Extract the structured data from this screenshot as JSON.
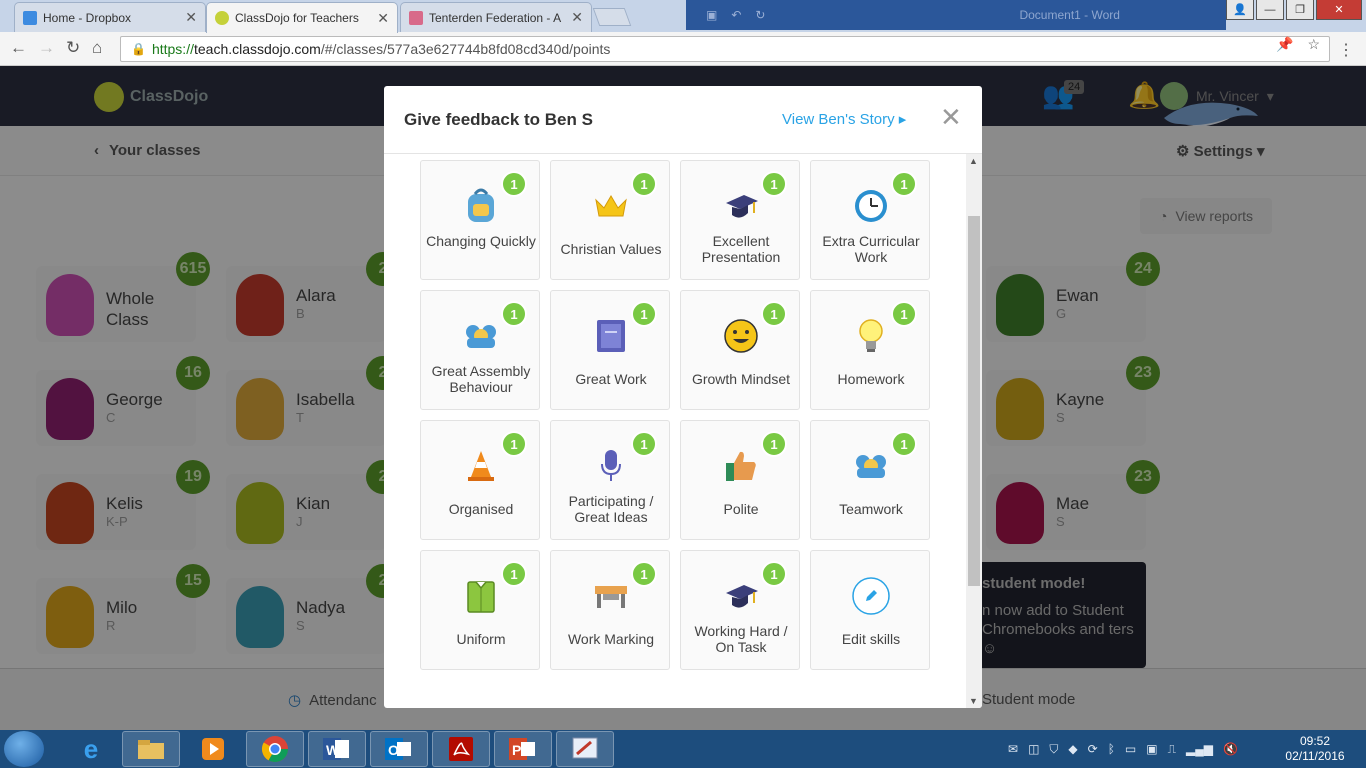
{
  "browser": {
    "tabs": [
      {
        "title": "Home - Dropbox",
        "close": "✕"
      },
      {
        "title": "ClassDojo for Teachers",
        "close": "✕"
      },
      {
        "title": "Tenterden Federation - A",
        "close": "✕"
      }
    ],
    "background_window_title": "Document1 - Word",
    "url_prefix": "https://",
    "url_host": "teach.classdojo.com",
    "url_path": "/#/classes/577a3e627744b8fd08cd340d/points"
  },
  "header": {
    "logo": "ClassDojo",
    "notifications_count": "24",
    "user_name": "Mr. Vincer"
  },
  "subbar": {
    "back_label": "Your classes",
    "settings_label": "Settings",
    "view_reports_label": "View reports"
  },
  "students": [
    {
      "name": "Whole Class",
      "initial": "",
      "points": "615",
      "color": "#c94fb0"
    },
    {
      "name": "Alara",
      "initial": "B",
      "points": "2",
      "color": "#c0392b"
    },
    {
      "name": "Ewan",
      "initial": "G",
      "points": "24",
      "color": "#3f7f2a"
    },
    {
      "name": "George",
      "initial": "C",
      "points": "16",
      "color": "#8e1f6e"
    },
    {
      "name": "Isabella",
      "initial": "T",
      "points": "2",
      "color": "#d9a53a"
    },
    {
      "name": "Kayne",
      "initial": "S",
      "points": "23",
      "color": "#c8a21a"
    },
    {
      "name": "Kelis",
      "initial": "K-P",
      "points": "19",
      "color": "#c0441f"
    },
    {
      "name": "Kian",
      "initial": "J",
      "points": "2",
      "color": "#a6b520"
    },
    {
      "name": "Mae",
      "initial": "S",
      "points": "23",
      "color": "#a4134a"
    },
    {
      "name": "Milo",
      "initial": "R",
      "points": "15",
      "color": "#d9a21a"
    },
    {
      "name": "Nadya",
      "initial": "S",
      "points": "2",
      "color": "#3a9ab0"
    }
  ],
  "tooltip": {
    "title": "student mode!",
    "body": "n now add to Student Chromebooks and ters ☺"
  },
  "bottombar": {
    "attendance": "Attendanc",
    "student_mode": "Student mode"
  },
  "modal": {
    "title": "Give feedback to Ben S",
    "story_link": "View Ben's Story ▸",
    "close": "✕",
    "skills": [
      {
        "label": "Changing Quickly",
        "points": "1",
        "icon": "backpack-icon"
      },
      {
        "label": "Christian Values",
        "points": "1",
        "icon": "crown-icon"
      },
      {
        "label": "Excellent Presentation",
        "points": "1",
        "icon": "graduation-cap-icon"
      },
      {
        "label": "Extra Curricular Work",
        "points": "1",
        "icon": "clock-icon"
      },
      {
        "label": "Great Assembly Behaviour",
        "points": "1",
        "icon": "group-icon"
      },
      {
        "label": "Great Work",
        "points": "1",
        "icon": "book-icon"
      },
      {
        "label": "Growth Mindset",
        "points": "1",
        "icon": "smiley-icon"
      },
      {
        "label": "Homework",
        "points": "1",
        "icon": "lightbulb-icon"
      },
      {
        "label": "Organised",
        "points": "1",
        "icon": "cone-icon"
      },
      {
        "label": "Participating / Great Ideas",
        "points": "1",
        "icon": "microphone-icon"
      },
      {
        "label": "Polite",
        "points": "1",
        "icon": "thumbs-up-icon"
      },
      {
        "label": "Teamwork",
        "points": "1",
        "icon": "group-icon"
      },
      {
        "label": "Uniform",
        "points": "1",
        "icon": "shirt-icon"
      },
      {
        "label": "Work Marking",
        "points": "1",
        "icon": "desk-icon"
      },
      {
        "label": "Working Hard / On Task",
        "points": "1",
        "icon": "graduation-cap-icon"
      },
      {
        "label": "Edit skills",
        "points": "",
        "icon": "pencil-icon"
      }
    ]
  },
  "taskbar": {
    "apps": [
      "explorer",
      "ie",
      "folder",
      "media",
      "chrome",
      "word",
      "outlook",
      "acrobat",
      "powerpoint",
      "paint"
    ],
    "time": "09:52",
    "date": "02/11/2016"
  }
}
